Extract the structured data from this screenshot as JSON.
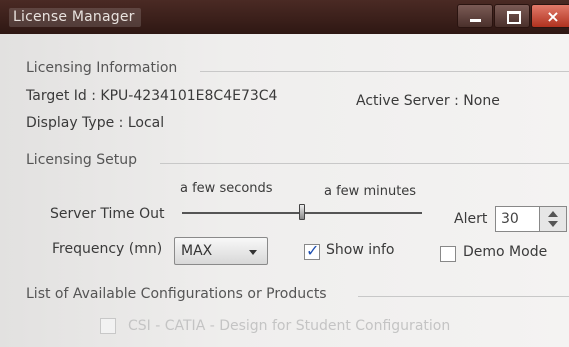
{
  "window": {
    "title": "License  Manager",
    "close_glyph": "×"
  },
  "licensing_info": {
    "group_title": "Licensing Information",
    "target_id": "Target Id : KPU-4234101E8C4E73C4",
    "active_server": "Active Server : None",
    "display_type": "Display Type : Local"
  },
  "licensing_setup": {
    "group_title": "Licensing Setup",
    "slider_left_label": "a few seconds",
    "slider_right_label": "a few minutes",
    "server_timeout_label": "Server Time Out",
    "alert_label": "Alert",
    "alert_value": "30",
    "frequency_label": "Frequency (mn)",
    "frequency_value": "MAX",
    "show_info_label": "Show info",
    "show_info_checked": true,
    "demo_mode_label": "Demo Mode",
    "demo_mode_checked": false
  },
  "configurations": {
    "group_title": "List of Available Configurations or Products",
    "items": [
      {
        "label": "CSI - CATIA - Design for Student Configuration",
        "checked": false
      }
    ]
  },
  "colors": {
    "titlebar": "#3a1f1a",
    "close_button": "#c0402c",
    "accent": "#1f4fb0"
  },
  "icons": {
    "minimize": "minimize-icon",
    "maximize": "maximize-icon",
    "close": "close-icon",
    "dropdown": "chevron-down-icon"
  }
}
